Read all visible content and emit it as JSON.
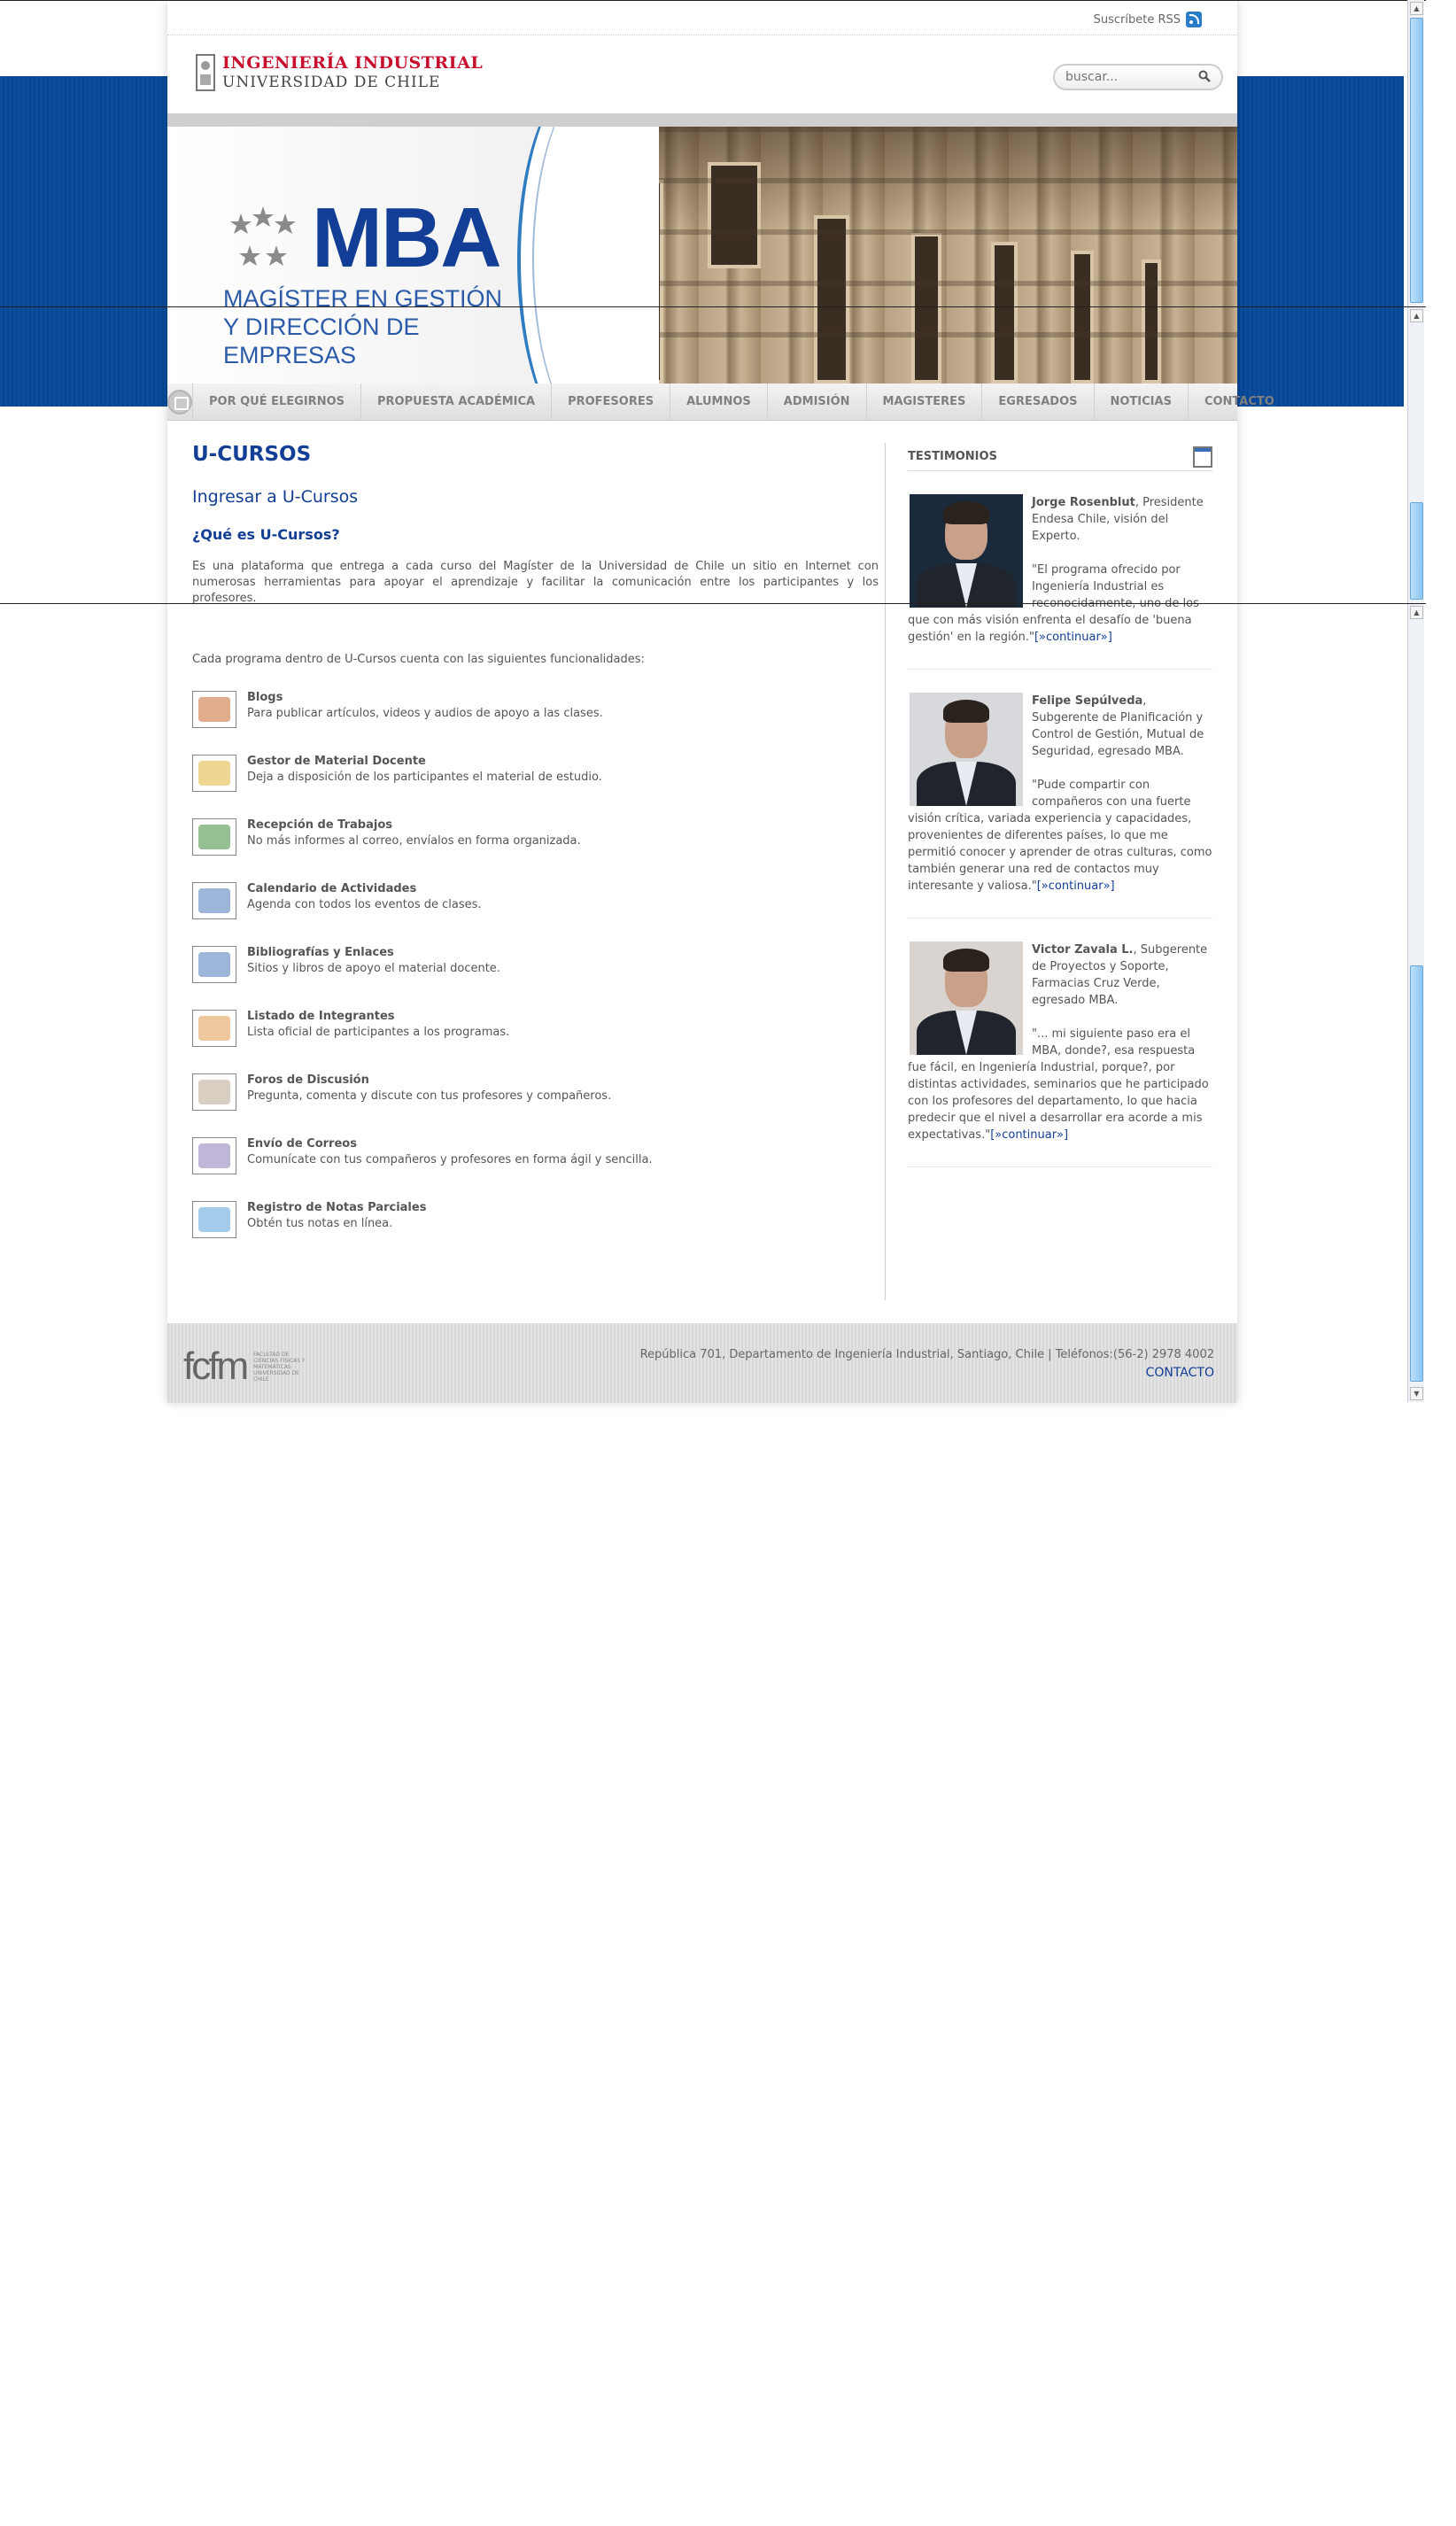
{
  "topbar": {
    "rss_label": "Suscríbete RSS"
  },
  "logo": {
    "line1": "INGENIERÍA INDUSTRIAL",
    "line2": "UNIVERSIDAD DE CHILE"
  },
  "search": {
    "placeholder": "buscar..."
  },
  "banner": {
    "title": "MBA",
    "subtitle": "MAGÍSTER EN GESTIÓN Y DIRECCIÓN DE EMPRESAS"
  },
  "nav": {
    "items": [
      "POR QUÉ ELEGIRNOS",
      "PROPUESTA ACADÉMICA",
      "PROFESORES",
      "ALUMNOS",
      "ADMISIÓN",
      "MAGISTERES",
      "EGRESADOS",
      "NOTICIAS",
      "CONTACTO"
    ]
  },
  "main": {
    "title": "U-CURSOS",
    "login_link": "Ingresar a U-Cursos",
    "question": "¿Qué es U-Cursos?",
    "intro": "Es una plataforma que entrega a cada curso del Magíster de la Universidad de Chile un sitio en Internet con numerosas herramientas para apoyar el aprendizaje y facilitar la comunicación entre los participantes y los profesores.",
    "features_intro": "Cada programa dentro de U-Cursos cuenta con las siguientes funcionalidades:",
    "features": [
      {
        "title": "Blogs",
        "desc": "Para publicar artículos, videos y audios de apoyo a las clases.",
        "icon": "blog-icon",
        "color": "#c96a2e"
      },
      {
        "title": "Gestor de Material Docente",
        "desc": "Deja a disposición de los participantes el material de estudio.",
        "icon": "teacher-material-icon",
        "color": "#e0b53a"
      },
      {
        "title": "Recepción de Trabajos",
        "desc": "No más informes al correo, envíalos en forma organizada.",
        "icon": "assignment-icon",
        "color": "#3f8a3a"
      },
      {
        "title": "Calendario de Actividades",
        "desc": "Agenda con todos los eventos de clases.",
        "icon": "calendar-icon",
        "color": "#4a78b8"
      },
      {
        "title": "Bibliografías y Enlaces",
        "desc": "Sitios y libros de apoyo el material docente.",
        "icon": "links-icon",
        "color": "#4a78b8"
      },
      {
        "title": "Listado de Integrantes",
        "desc": "Lista oficial de participantes a los programas.",
        "icon": "members-icon",
        "color": "#e09a4a"
      },
      {
        "title": "Foros de Discusión",
        "desc": "Pregunta, comenta y discute con tus profesores y compañeros.",
        "icon": "forum-icon",
        "color": "#b8a890"
      },
      {
        "title": "Envío de Correos",
        "desc": "Comunícate con tus compañeros y profesores en forma ágil y sencilla.",
        "icon": "mail-icon",
        "color": "#8a7ab8"
      },
      {
        "title": "Registro de Notas Parciales",
        "desc": "Obtén tus notas en línea.",
        "icon": "grades-icon",
        "color": "#5aa0d8"
      }
    ]
  },
  "sidebar": {
    "title": "TESTIMONIOS",
    "more_label": "[»continuar»]",
    "testimonials": [
      {
        "name": "Jorge Rosenblut",
        "role": ", Presidente Endesa Chile, visión del Experto.",
        "quote": "\"El programa ofrecido por Ingeniería Industrial es reconocidamente, uno de los que con más visión enfrenta el desafío de 'buena gestión' en la región.\""
      },
      {
        "name": "Felipe Sepúlveda",
        "role": ", Subgerente de Planificación y Control de Gestión, Mutual de Seguridad, egresado MBA.",
        "quote": "\"Pude compartir con compañeros con una fuerte visión crítica, variada experiencia y capacidades, provenientes de diferentes países, lo que me permitió conocer y aprender de otras culturas, como también generar una red de contactos muy interesante y valiosa.\""
      },
      {
        "name": "Victor Zavala L.",
        "role": ", Subgerente de Proyectos y Soporte, Farmacias Cruz Verde, egresado MBA.",
        "quote": "\"... mi siguiente paso era el MBA, donde?, esa respuesta fue fácil, en Ingeniería Industrial, porque?, por distintas actividades, seminarios que he participado con los profesores del departamento, lo que hacia predecir que el nivel a desarrollar era acorde a mis expectativas.\""
      }
    ]
  },
  "footer": {
    "logo_text": "fcfm",
    "logo_small": "FACULTAD DE CIENCIAS FÍSICAS Y MATEMÁTICAS UNIVERSIDAD DE CHILE",
    "address": "República 701, Departamento de Ingeniería Industrial, Santiago, Chile | Teléfonos:(56-2) 2978 4002",
    "contact": "CONTACTO"
  },
  "colors": {
    "brand_blue": "#123e96",
    "band_blue": "#0b4d9c",
    "logo_red": "#c8102e"
  }
}
